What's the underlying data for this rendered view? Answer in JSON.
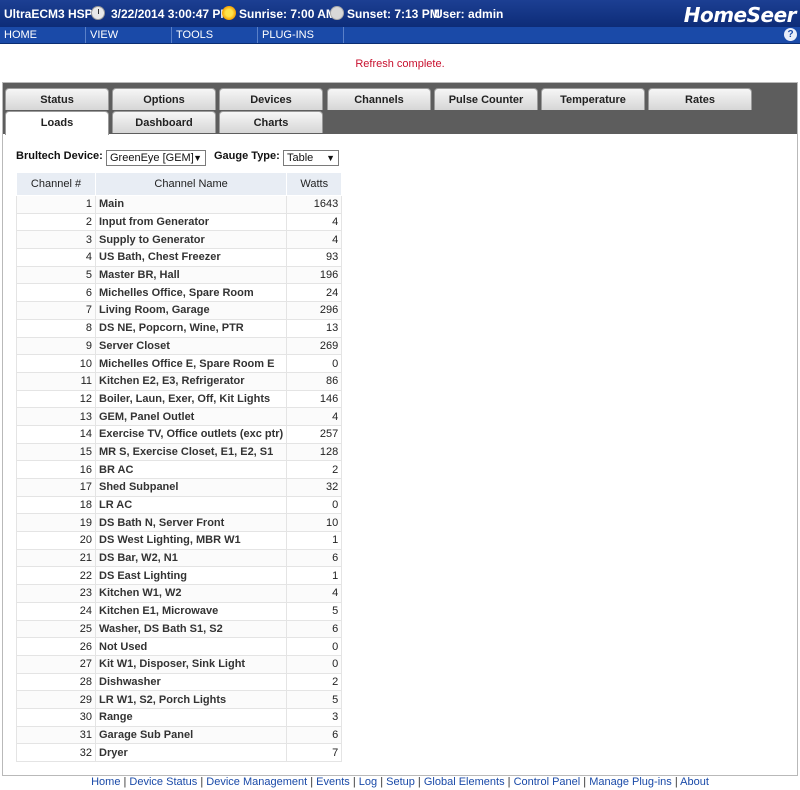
{
  "titlebar": {
    "plugin_name": "UltraECM3 HSPI",
    "datetime": "3/22/2014 3:00:47 PM",
    "sunrise": "Sunrise: 7:00 AM",
    "sunset": "Sunset: 7:13 PM",
    "user": "User: admin",
    "logo": "HomeSeer",
    "icons": {
      "clock": "clock-icon",
      "sun": "sun-icon",
      "moon": "moon-icon"
    }
  },
  "menu": {
    "home": "HOME",
    "view": "VIEW",
    "tools": "TOOLS",
    "plugins": "PLUG-INS",
    "help": "?"
  },
  "status_message": "Refresh complete.",
  "tabs_row1": [
    "Status",
    "Options",
    "Devices",
    "Channels",
    "Pulse Counter",
    "Temperature",
    "Rates"
  ],
  "tabs_row2": [
    "Loads",
    "Dashboard",
    "Charts"
  ],
  "active_tab": "Loads",
  "controls": {
    "device_label": "Brultech Device:",
    "device_value": "GreenEye [GEM]",
    "gauge_label": "Gauge Type:",
    "gauge_value": "Table"
  },
  "table": {
    "headers": [
      "Channel #",
      "Channel Name",
      "Watts"
    ],
    "rows": [
      [
        "1",
        "Main",
        "1643"
      ],
      [
        "2",
        "Input from Generator",
        "4"
      ],
      [
        "3",
        "Supply to Generator",
        "4"
      ],
      [
        "4",
        "US Bath, Chest Freezer",
        "93"
      ],
      [
        "5",
        "Master BR, Hall",
        "196"
      ],
      [
        "6",
        "Michelles Office, Spare Room",
        "24"
      ],
      [
        "7",
        "Living Room, Garage",
        "296"
      ],
      [
        "8",
        "DS NE, Popcorn, Wine, PTR",
        "13"
      ],
      [
        "9",
        "Server Closet",
        "269"
      ],
      [
        "10",
        "Michelles Office E, Spare Room E",
        "0"
      ],
      [
        "11",
        "Kitchen E2, E3, Refrigerator",
        "86"
      ],
      [
        "12",
        "Boiler, Laun, Exer, Off, Kit Lights",
        "146"
      ],
      [
        "13",
        "GEM, Panel Outlet",
        "4"
      ],
      [
        "14",
        "Exercise TV, Office outlets (exc ptr)",
        "257"
      ],
      [
        "15",
        "MR S, Exercise Closet, E1, E2, S1",
        "128"
      ],
      [
        "16",
        "BR AC",
        "2"
      ],
      [
        "17",
        "Shed Subpanel",
        "32"
      ],
      [
        "18",
        "LR AC",
        "0"
      ],
      [
        "19",
        "DS Bath N, Server Front",
        "10"
      ],
      [
        "20",
        "DS West Lighting, MBR W1",
        "1"
      ],
      [
        "21",
        "DS Bar, W2, N1",
        "6"
      ],
      [
        "22",
        "DS East Lighting",
        "1"
      ],
      [
        "23",
        "Kitchen W1, W2",
        "4"
      ],
      [
        "24",
        "Kitchen E1, Microwave",
        "5"
      ],
      [
        "25",
        "Washer, DS Bath S1, S2",
        "6"
      ],
      [
        "26",
        "Not Used",
        "0"
      ],
      [
        "27",
        "Kit W1, Disposer, Sink Light",
        "0"
      ],
      [
        "28",
        "Dishwasher",
        "2"
      ],
      [
        "29",
        "LR W1, S2, Porch Lights",
        "5"
      ],
      [
        "30",
        "Range",
        "3"
      ],
      [
        "31",
        "Garage Sub Panel",
        "6"
      ],
      [
        "32",
        "Dryer",
        "7"
      ]
    ]
  },
  "footer_links": [
    "Home",
    "Device Status",
    "Device Management",
    "Events",
    "Log",
    "Setup",
    "Global Elements",
    "Control Panel",
    "Manage Plug-ins",
    "About"
  ],
  "colors": {
    "titlebar": "#0d2c78",
    "menubar": "#1a4aa8",
    "tabband": "#5d5d5d",
    "status_text": "#c8102e",
    "header_bg": "#e8edf4"
  }
}
